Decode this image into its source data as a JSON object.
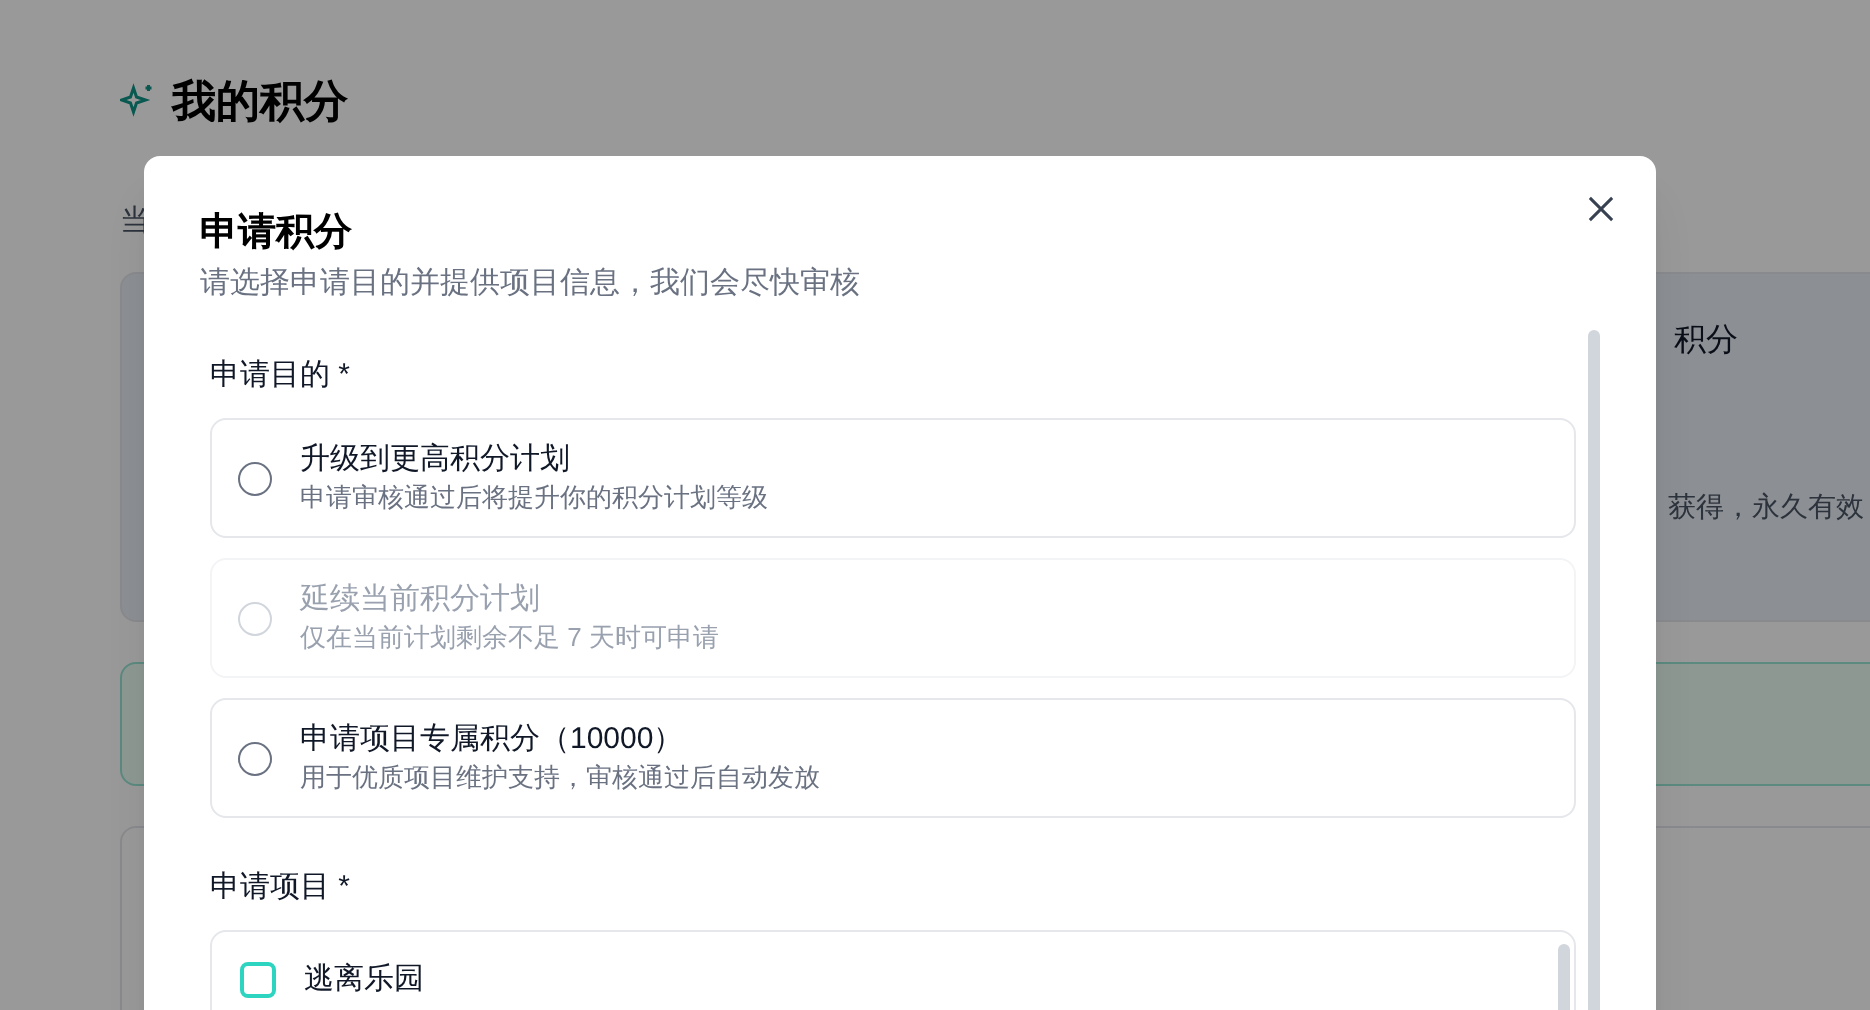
{
  "page": {
    "title": "我的积分",
    "subtitle": "当",
    "plan_card": {
      "title": "积分",
      "note": "获得，永久有效"
    }
  },
  "dialog": {
    "title": "申请积分",
    "subtitle": "请选择申请目的并提供项目信息，我们会尽快审核",
    "purpose": {
      "label": "申请目的 *",
      "options": [
        {
          "title": "升级到更高积分计划",
          "description": "申请审核通过后将提升你的积分计划等级",
          "selected": false,
          "disabled": false
        },
        {
          "title": "延续当前积分计划",
          "description": "仅在当前计划剩余不足 7 天时可申请",
          "selected": false,
          "disabled": true
        },
        {
          "title": "申请项目专属积分（10000）",
          "description": "用于优质项目维护支持，审核通过后自动发放",
          "selected": false,
          "disabled": false
        }
      ]
    },
    "projects": {
      "label": "申请项目 *",
      "items": [
        {
          "name": "逃离乐园",
          "checked": false
        }
      ]
    }
  }
}
